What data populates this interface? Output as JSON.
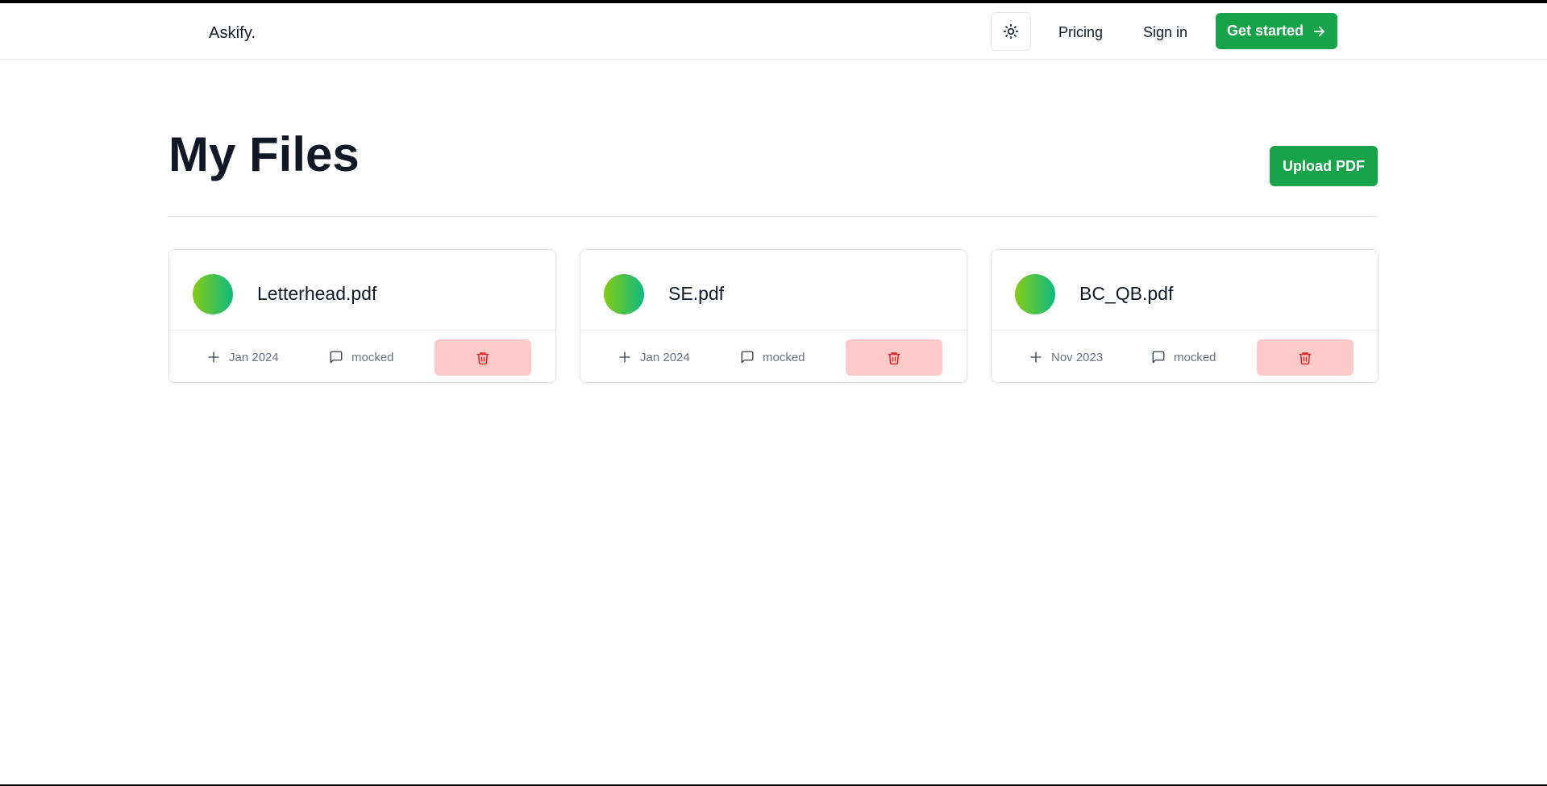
{
  "navbar": {
    "brand": "Askify.",
    "theme_toggle_icon": "sun-icon",
    "links": {
      "pricing": "Pricing",
      "sign_in": "Sign in"
    },
    "cta_label": "Get started",
    "cta_icon": "arrow-right-icon"
  },
  "header": {
    "title": "My Files",
    "upload_label": "Upload PDF"
  },
  "files": [
    {
      "name": "Letterhead.pdf",
      "date": "Jan 2024",
      "messages": "mocked"
    },
    {
      "name": "SE.pdf",
      "date": "Jan 2024",
      "messages": "mocked"
    },
    {
      "name": "BC_QB.pdf",
      "date": "Nov 2023",
      "messages": "mocked"
    }
  ],
  "icons": {
    "date": "plus-icon",
    "messages": "message-square-icon",
    "delete": "trash-icon"
  },
  "colors": {
    "primary": "#16a34a",
    "delete_bg": "#fecaca",
    "delete_icon": "#dc2626",
    "avatar_gradient_start": "#84cc16",
    "avatar_gradient_end": "#10b981",
    "text": "#111827",
    "muted_text": "#6b7280"
  }
}
